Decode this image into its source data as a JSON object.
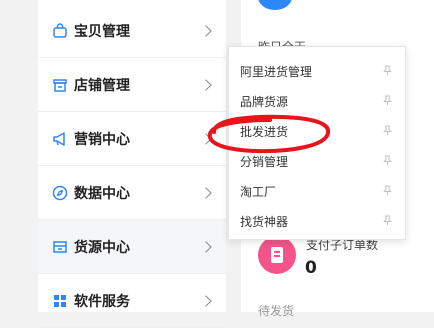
{
  "sidebar": {
    "items": [
      {
        "label": "宝贝管理",
        "icon": "bag-icon"
      },
      {
        "label": "店铺管理",
        "icon": "store-icon"
      },
      {
        "label": "营销中心",
        "icon": "megaphone-icon"
      },
      {
        "label": "数据中心",
        "icon": "compass-icon"
      },
      {
        "label": "货源中心",
        "icon": "box-icon"
      },
      {
        "label": "软件服务",
        "icon": "apps-icon"
      }
    ]
  },
  "popup": {
    "items": [
      {
        "label": "阿里进货管理"
      },
      {
        "label": "品牌货源"
      },
      {
        "label": "批发进货"
      },
      {
        "label": "分销管理"
      },
      {
        "label": "淘工厂"
      },
      {
        "label": "找货神器"
      }
    ]
  },
  "main": {
    "yesterday_text": "昨日全天",
    "stat_label": "支付子订单数",
    "stat_value": "0",
    "bottom_text": "待发货"
  },
  "colors": {
    "accent_blue": "#2f86f6",
    "stat_pink": "#f4548a",
    "annotation_red": "#e8141c"
  }
}
